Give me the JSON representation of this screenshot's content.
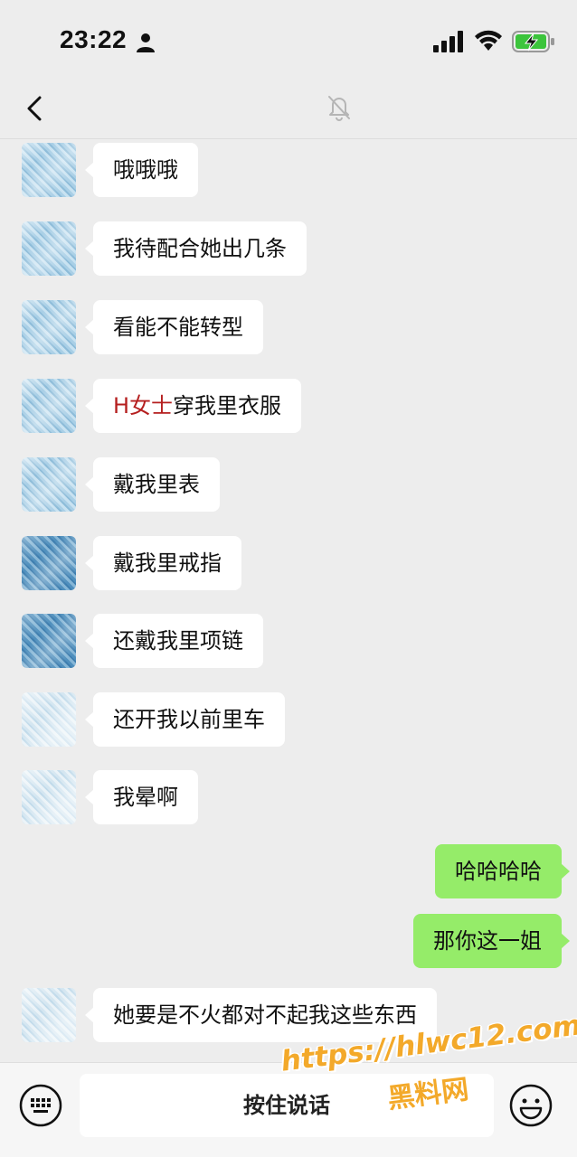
{
  "status_bar": {
    "time": "23:22",
    "icons": [
      "person-icon",
      "signal-icon",
      "wifi-icon",
      "battery-charging-icon"
    ]
  },
  "nav": {
    "icons": [
      "back-icon",
      "mute-icon"
    ]
  },
  "messages": [
    {
      "side": "in",
      "text": "哦哦哦"
    },
    {
      "side": "in",
      "text": "我待配合她出几条"
    },
    {
      "side": "in",
      "text": "看能不能转型"
    },
    {
      "side": "in",
      "highlight": "H女士",
      "text": "穿我里衣服"
    },
    {
      "side": "in",
      "text": "戴我里表"
    },
    {
      "side": "in",
      "text": "戴我里戒指"
    },
    {
      "side": "in",
      "text": "还戴我里项链"
    },
    {
      "side": "in",
      "text": "还开我以前里车"
    },
    {
      "side": "in",
      "text": "我晕啊"
    },
    {
      "side": "out",
      "text": "哈哈哈哈"
    },
    {
      "side": "out",
      "text": "那你这一姐"
    },
    {
      "side": "in",
      "text": "她要是不火都对不起我这些东西"
    }
  ],
  "input_bar": {
    "hold_to_talk": "按住说话"
  },
  "watermark": {
    "url": "https://hlwc12.com",
    "name": "黑料网"
  },
  "colors": {
    "background": "#ededed",
    "incoming_bubble": "#ffffff",
    "outgoing_bubble": "#95ec69",
    "highlight_text": "#b51f1f",
    "watermark": "#f3a92a"
  }
}
